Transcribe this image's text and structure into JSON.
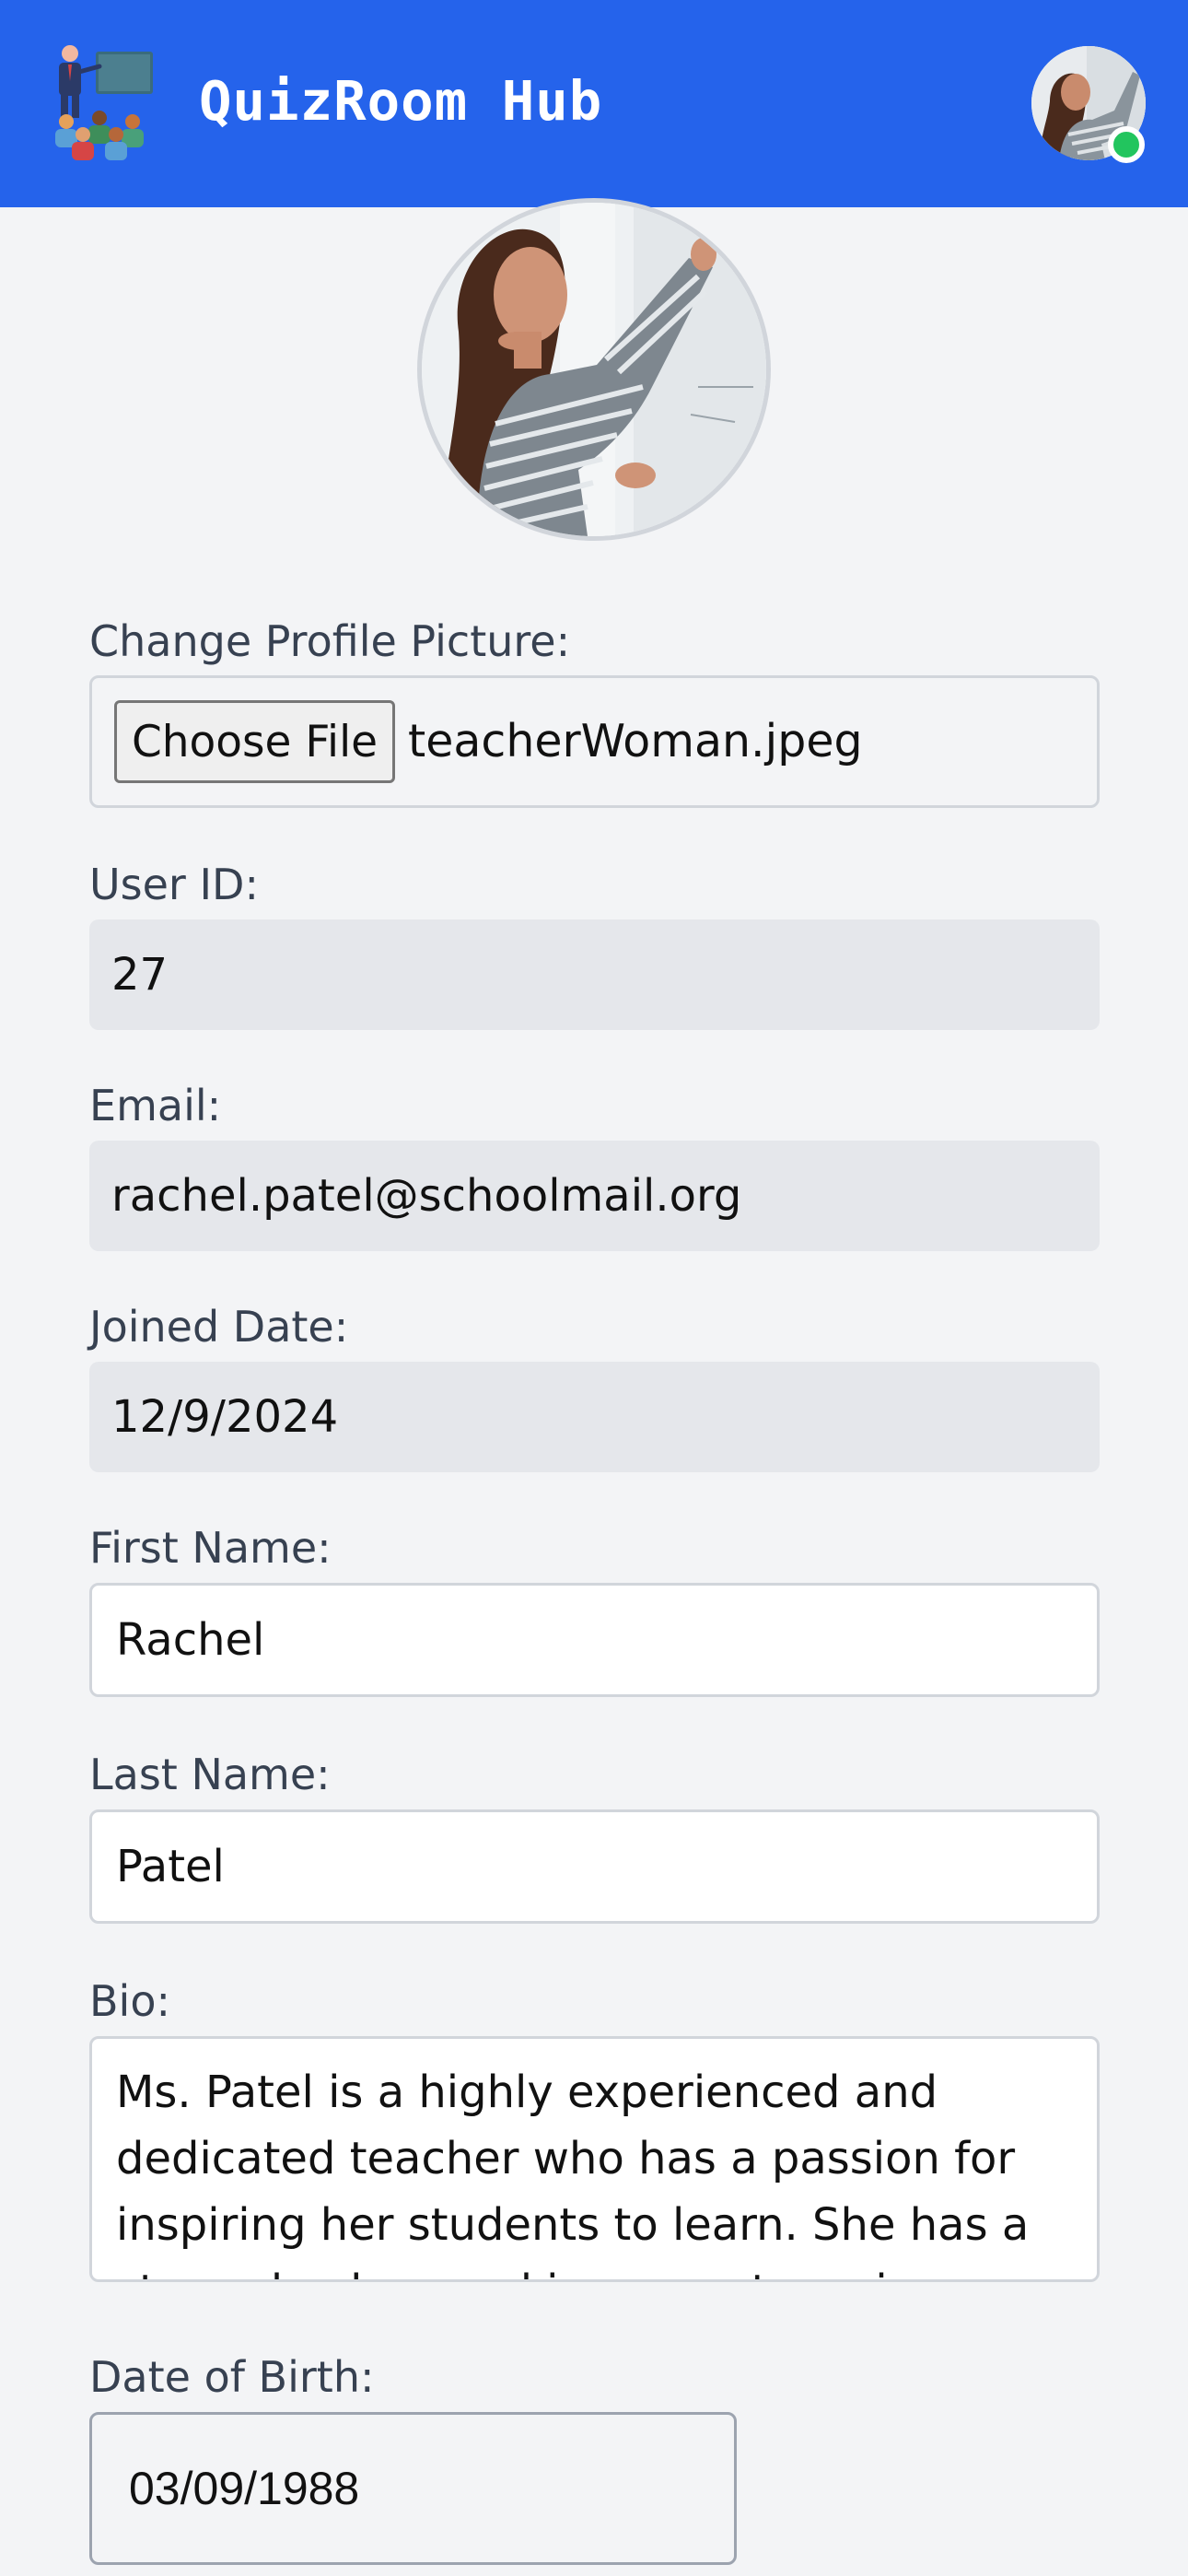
{
  "header": {
    "app_title": "QuizRoom Hub",
    "logo_icon": "classroom-teacher-icon",
    "avatar_status": "online",
    "brand_color": "#2563eb",
    "status_color": "#22c55e"
  },
  "profile": {
    "photo_icon": "profile-photo"
  },
  "file_upload": {
    "label": "Change Profile Picture:",
    "button_label": "Choose File",
    "file_name": "teacherWoman.jpeg"
  },
  "fields": {
    "user_id": {
      "label": "User ID:",
      "value": "27"
    },
    "email": {
      "label": "Email:",
      "value": "rachel.patel@schoolmail.org"
    },
    "joined_date": {
      "label": "Joined Date:",
      "value": "12/9/2024"
    },
    "first_name": {
      "label": "First Name:",
      "value": "Rachel"
    },
    "last_name": {
      "label": "Last Name:",
      "value": "Patel"
    },
    "bio": {
      "label": "Bio:",
      "value": "Ms. Patel is a highly experienced and dedicated teacher who has a passion for inspiring her students to learn. She has a strong background in computer science and a"
    },
    "date_of_birth": {
      "label": "Date of Birth:",
      "value": "03/09/1988"
    }
  }
}
